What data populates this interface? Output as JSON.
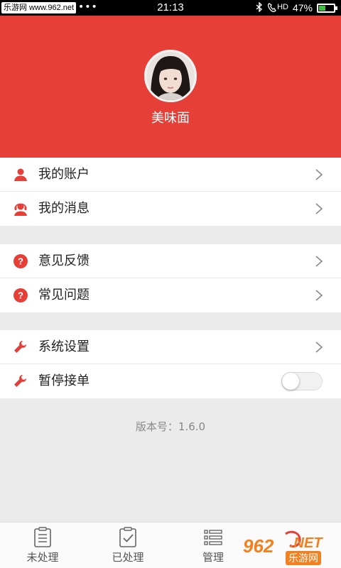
{
  "status_bar": {
    "watermark": "乐游网 www.962.net",
    "dots": "•••",
    "time": "21:13",
    "hd": "HD",
    "battery_percent": "47%",
    "battery_level": 0.47,
    "bluetooth_icon": "bluetooth-icon",
    "phone_icon": "phone-hd-icon"
  },
  "profile": {
    "username": "美味面",
    "avatar_icon": "avatar-photo"
  },
  "menu": {
    "account": {
      "label": "我的账户",
      "icon": "person-icon"
    },
    "messages": {
      "label": "我的消息",
      "icon": "headset-person-icon"
    },
    "feedback": {
      "label": "意见反馈",
      "icon": "question-circle-icon"
    },
    "faq": {
      "label": "常见问题",
      "icon": "question-circle-icon"
    },
    "settings": {
      "label": "系统设置",
      "icon": "wrench-icon"
    },
    "pause_orders": {
      "label": "暂停接单",
      "icon": "wrench-icon",
      "toggle_on": false
    }
  },
  "version_text": "版本号：1.6.0",
  "tabs": [
    {
      "label": "未处理",
      "icon": "document-list-icon"
    },
    {
      "label": "已处理",
      "icon": "clipboard-check-icon"
    },
    {
      "label": "管理",
      "icon": "list-manage-icon"
    }
  ],
  "corner_watermark": {
    "text": "962",
    "suffix": ".NET",
    "sub": "乐游网"
  },
  "colors": {
    "brand_red": "#e53f37",
    "background": "#ebebeb",
    "battery_green": "#3fbf3f"
  }
}
